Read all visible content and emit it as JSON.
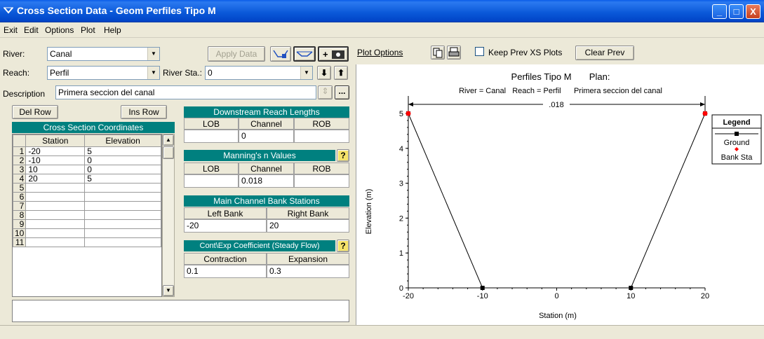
{
  "window": {
    "title": "Cross Section Data - Geom Perfiles Tipo M",
    "minimize": "_",
    "maximize": "□",
    "close": "X"
  },
  "menu": [
    "Exit",
    "Edit",
    "Options",
    "Plot",
    "Help"
  ],
  "river": {
    "label": "River:",
    "value": "Canal"
  },
  "reach": {
    "label": "Reach:",
    "value": "Perfil"
  },
  "river_sta": {
    "label": "River Sta.:",
    "value": "0"
  },
  "description": {
    "label": "Description",
    "value": "Primera seccion del canal"
  },
  "toolbar": {
    "apply_data": "Apply Data",
    "plot_options": "Plot Options",
    "keep_prev": "Keep Prev XS Plots",
    "clear_prev": "Clear Prev",
    "ellipsis": "..."
  },
  "grid": {
    "del_row": "Del Row",
    "ins_row": "Ins Row",
    "title": "Cross Section Coordinates",
    "columns": [
      "Station",
      "Elevation"
    ],
    "rows": [
      [
        "1",
        "-20",
        "5"
      ],
      [
        "2",
        "-10",
        "0"
      ],
      [
        "3",
        "10",
        "0"
      ],
      [
        "4",
        "20",
        "5"
      ],
      [
        "5",
        "",
        ""
      ],
      [
        "6",
        "",
        ""
      ],
      [
        "7",
        "",
        ""
      ],
      [
        "8",
        "",
        ""
      ],
      [
        "9",
        "",
        ""
      ],
      [
        "10",
        "",
        ""
      ],
      [
        "11",
        "",
        ""
      ]
    ]
  },
  "downstream": {
    "title": "Downstream Reach Lengths",
    "cols": [
      "LOB",
      "Channel",
      "ROB"
    ],
    "values": [
      "",
      "0",
      ""
    ]
  },
  "manning": {
    "title": "Manning's n Values",
    "help": "?",
    "cols": [
      "LOB",
      "Channel",
      "ROB"
    ],
    "values": [
      "",
      "0.018",
      ""
    ]
  },
  "bank": {
    "title": "Main Channel Bank Stations",
    "cols": [
      "Left Bank",
      "Right Bank"
    ],
    "values": [
      "-20",
      "20"
    ]
  },
  "coeff": {
    "title": "Cont\\Exp Coefficient (Steady Flow)",
    "help": "?",
    "cols": [
      "Contraction",
      "Expansion"
    ],
    "values": [
      "0.1",
      "0.3"
    ]
  },
  "chart_data": {
    "type": "line",
    "title": "Perfiles Tipo M       Plan:",
    "subtitle": "River = Canal   Reach = Perfil      Primera seccion del canal",
    "xlabel": "Station (m)",
    "ylabel": "Elevation (m)",
    "xlim": [
      -20,
      20
    ],
    "ylim": [
      0,
      5
    ],
    "xticks": [
      -20,
      -10,
      0,
      10,
      20
    ],
    "yticks": [
      0,
      1,
      2,
      3,
      4,
      5
    ],
    "n_label": ".018",
    "series": [
      {
        "name": "Ground",
        "x": [
          -20,
          -10,
          10,
          20
        ],
        "y": [
          5,
          0,
          0,
          5
        ],
        "color": "#000000"
      },
      {
        "name": "Bank Sta",
        "x": [
          -20,
          20
        ],
        "y": [
          5,
          5
        ],
        "color": "#ff0000"
      }
    ],
    "legend_title": "Legend",
    "legend_position": "right"
  }
}
